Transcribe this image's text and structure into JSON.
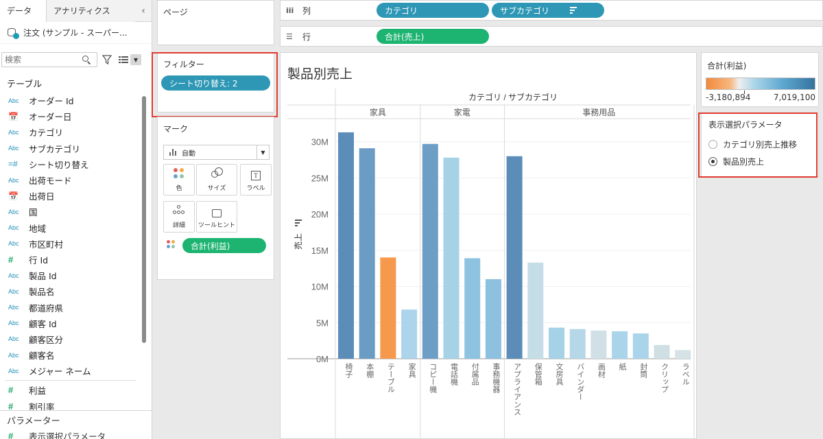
{
  "data_pane": {
    "tab_data": "データ",
    "tab_analytics": "アナリティクス",
    "collapse_glyph": "‹",
    "datasource": "注文 (サンプル - スーパー...",
    "search_placeholder": "検索",
    "section_tables": "テーブル",
    "fields": [
      {
        "type": "Abc",
        "name": "オーダー Id"
      },
      {
        "type": "📅",
        "name": "オーダー日"
      },
      {
        "type": "Abc",
        "name": "カテゴリ"
      },
      {
        "type": "Abc",
        "name": "サブカテゴリ"
      },
      {
        "type": "=#",
        "name": "シート切り替え"
      },
      {
        "type": "Abc",
        "name": "出荷モード"
      },
      {
        "type": "📅",
        "name": "出荷日"
      },
      {
        "type": "Abc",
        "name": "国"
      },
      {
        "type": "Abc",
        "name": "地域"
      },
      {
        "type": "Abc",
        "name": "市区町村"
      },
      {
        "type": "#",
        "name": "行 Id"
      },
      {
        "type": "Abc",
        "name": "製品 Id"
      },
      {
        "type": "Abc",
        "name": "製品名"
      },
      {
        "type": "Abc",
        "name": "都道府県"
      },
      {
        "type": "Abc",
        "name": "顧客 Id"
      },
      {
        "type": "Abc",
        "name": "顧客区分"
      },
      {
        "type": "Abc",
        "name": "顧客名"
      },
      {
        "type": "Abc",
        "name": "メジャー ネーム"
      }
    ],
    "measures": [
      {
        "type": "#",
        "name": "利益"
      },
      {
        "type": "#",
        "name": "割引率"
      }
    ],
    "section_parameters": "パラメーター",
    "param_item": "表示選択パラメータ"
  },
  "pages": {
    "title": "ページ"
  },
  "filters": {
    "title": "フィルター",
    "pill": "シート切り替え: 2"
  },
  "marks": {
    "title": "マーク",
    "type": "自動",
    "color": "色",
    "size": "サイズ",
    "label": "ラベル",
    "detail": "詳細",
    "tooltip": "ツールヒント",
    "color_field": "合計(利益)"
  },
  "shelves": {
    "columns_label": "列",
    "columns_pills": [
      "カテゴリ",
      "サブカテゴリ"
    ],
    "rows_label": "行",
    "rows_pill": "合計(売上)"
  },
  "view": {
    "title": "製品別売上"
  },
  "legend": {
    "title": "合計(利益)",
    "min": "-3,180,894",
    "max": "7,019,100"
  },
  "parameter_card": {
    "title": "表示選択パラメータ",
    "options": [
      "カテゴリ別売上推移",
      "製品別売上"
    ],
    "selected": 1
  },
  "chart_data": {
    "type": "bar",
    "header": "カテゴリ / サブカテゴリ",
    "ylabel": "売上",
    "yticks": [
      "0M",
      "5M",
      "10M",
      "15M",
      "20M",
      "25M",
      "30M"
    ],
    "ylim": [
      0,
      33000000
    ],
    "categories": [
      {
        "name": "家具",
        "items": [
          {
            "label": "椅子",
            "value": 31300000,
            "color": "#5b8db8"
          },
          {
            "label": "本棚",
            "value": 29100000,
            "color": "#6b9cc4"
          },
          {
            "label": "テーブル",
            "value": 14000000,
            "color": "#f7994d"
          },
          {
            "label": "家具",
            "value": 6800000,
            "color": "#9dcde8"
          }
        ]
      },
      {
        "name": "家電",
        "items": [
          {
            "label": "コピー機",
            "value": 29700000,
            "color": "#6d9fc6"
          },
          {
            "label": "電話機",
            "value": 27800000,
            "color": "#a6d2e8"
          },
          {
            "label": "付属品",
            "value": 13900000,
            "color": "#8ec3e0"
          },
          {
            "label": "事務機器",
            "value": 11000000,
            "color": "#8ec0df"
          }
        ]
      },
      {
        "name": "事務用品",
        "items": [
          {
            "label": "アプライアンス",
            "value": 28000000,
            "color": "#5b8db8"
          },
          {
            "label": "保管箱",
            "value": 13300000,
            "color": "#c5dde6"
          },
          {
            "label": "文房具",
            "value": 4300000,
            "color": "#a6d2e8"
          },
          {
            "label": "バインダー",
            "value": 4100000,
            "color": "#b5d7e8"
          },
          {
            "label": "画材",
            "value": 3900000,
            "color": "#d0e0e6"
          },
          {
            "label": "紙",
            "value": 3800000,
            "color": "#a9d4e9"
          },
          {
            "label": "封筒",
            "value": 3500000,
            "color": "#a9d4e9"
          },
          {
            "label": "クリップ",
            "value": 1900000,
            "color": "#cfdfe4"
          },
          {
            "label": "ラベル",
            "value": 1200000,
            "color": "#d5e3e6"
          }
        ]
      }
    ]
  }
}
